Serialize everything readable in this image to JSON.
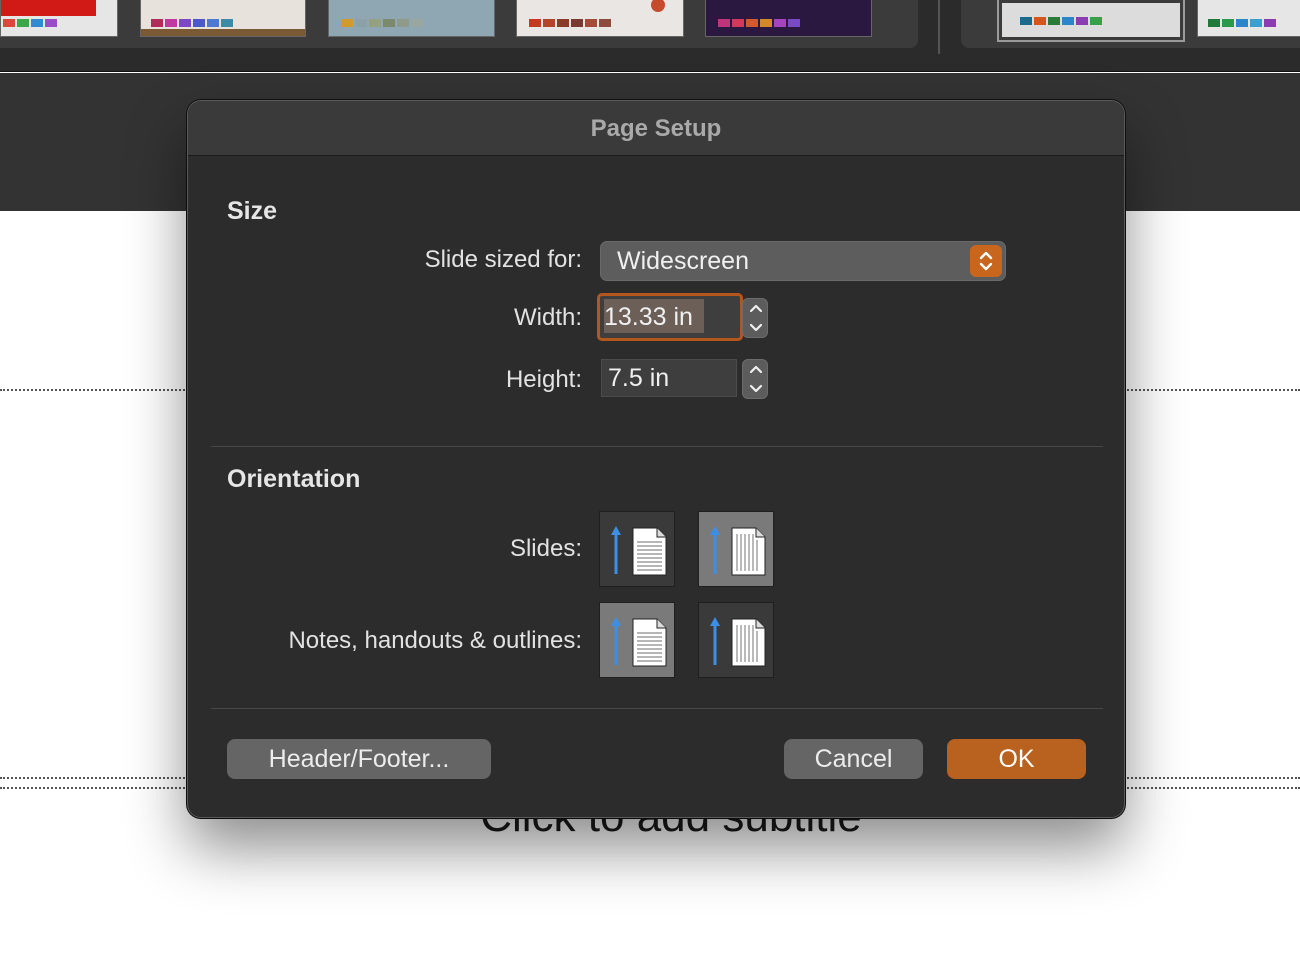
{
  "background": {
    "subtitle_placeholder": "Click to add subtitle"
  },
  "dialog": {
    "title": "Page Setup",
    "size_section": {
      "heading": "Size",
      "slide_sized_for_label": "Slide sized for:",
      "slide_sized_for_value": "Widescreen",
      "width_label": "Width:",
      "width_value": "13.33 in",
      "height_label": "Height:",
      "height_value": "7.5 in"
    },
    "orientation_section": {
      "heading": "Orientation",
      "slides_label": "Slides:",
      "slides_selected": "landscape",
      "notes_label": "Notes, handouts & outlines:",
      "notes_selected": "portrait"
    },
    "buttons": {
      "header_footer": "Header/Footer...",
      "cancel": "Cancel",
      "ok": "OK"
    }
  },
  "colors": {
    "accent": "#b9611f",
    "focus_ring": "#b5561d",
    "arrow_blue": "#3d8fe6"
  },
  "icons": [
    "up-down-chevron-icon",
    "stepper-arrows-icon",
    "portrait-page-icon",
    "landscape-page-icon"
  ]
}
